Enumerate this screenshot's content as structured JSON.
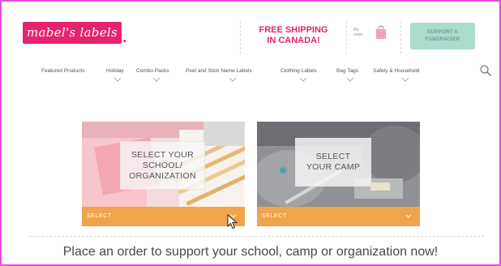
{
  "header": {
    "logo_text": "mabel's labels",
    "shipping_line1": "FREE SHIPPING",
    "shipping_line2": "IN CANADA!",
    "mini_text_line1": "My",
    "mini_text_line2": "order",
    "cart_icon": "shopping-bag-icon",
    "support_line1": "SUPPORT A",
    "support_line2": "FUNDRAISER",
    "brand_color": "#e6236e",
    "support_color": "#a9dccd"
  },
  "nav": {
    "items": [
      {
        "label": "Featured Products",
        "has_dropdown": false
      },
      {
        "label": "Holiday",
        "has_dropdown": true
      },
      {
        "label": "Combo Packs",
        "has_dropdown": true
      },
      {
        "label": "Peel and Stick Name Labels",
        "has_dropdown": true
      },
      {
        "label": "Clothing Labels",
        "has_dropdown": true
      },
      {
        "label": "Bag Tags",
        "has_dropdown": true
      },
      {
        "label": "Safety & Household",
        "has_dropdown": true
      }
    ],
    "search_icon": "search-icon"
  },
  "cards": [
    {
      "overlay_lines": [
        "SELECT YOUR",
        "SCHOOL/",
        "ORGANIZATION"
      ],
      "select_label": "SELECT"
    },
    {
      "overlay_lines": [
        "SELECT",
        "YOUR CAMP"
      ],
      "select_label": "SELECT"
    }
  ],
  "select_bar_color": "#f0a44c",
  "tagline": "Place an order to support your school, camp or organization now!"
}
